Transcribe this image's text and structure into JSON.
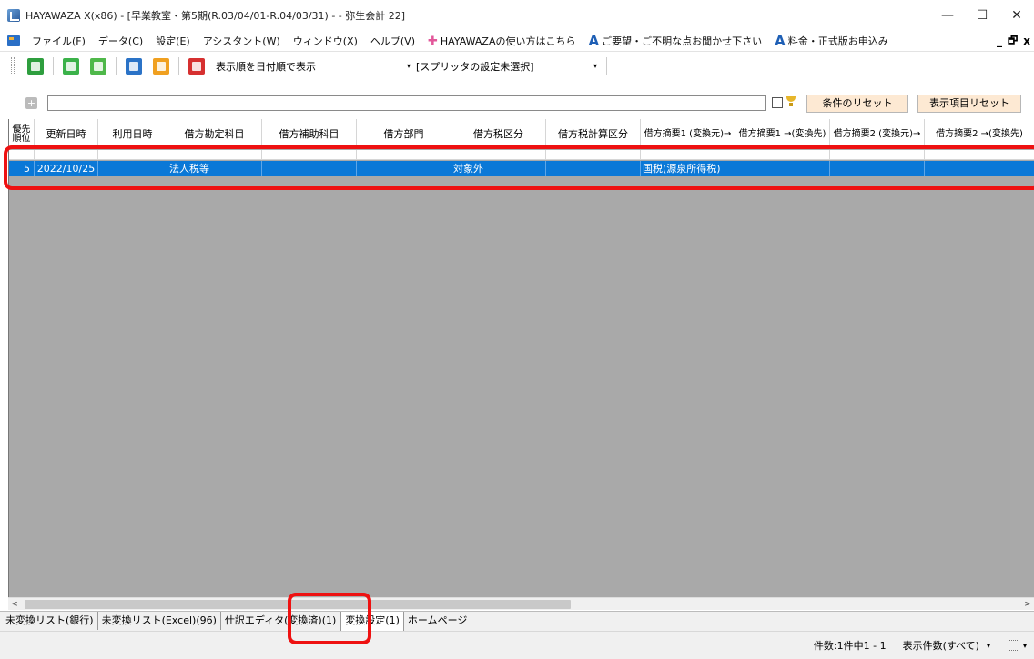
{
  "window": {
    "title": "HAYAWAZA X(x86) - [早業教室・第5期(R.03/04/01-R.04/03/31) - - 弥生会計 22]",
    "minimize": "—",
    "maximize": "☐",
    "close": "✕"
  },
  "menu": {
    "items": [
      "ファイル(F)",
      "データ(C)",
      "設定(E)",
      "アシスタント(W)",
      "ウィンドウ(X)",
      "ヘルプ(V)"
    ],
    "howto": "HAYAWAZAの使い方はこちら",
    "feedback": "ご要望・ご不明な点お聞かせ下さい",
    "pricing": "料金・正式版お申込み",
    "mdi_min": "_",
    "mdi_restore": "🗗",
    "mdi_close": "x"
  },
  "toolbar": {
    "sort_label": "表示順を日付順で表示",
    "spliter_label": "[スプリッタの設定未選択]",
    "arrow": "▾"
  },
  "filter": {
    "expand": "+",
    "reset_conditions": "条件のリセット",
    "reset_columns": "表示項目リセット"
  },
  "grid": {
    "columns": [
      {
        "label": "優先順位",
        "small": true
      },
      {
        "label": "更新日時"
      },
      {
        "label": "利用日時"
      },
      {
        "label": "借方勘定科目"
      },
      {
        "label": "借方補助科目"
      },
      {
        "label": "借方部門"
      },
      {
        "label": "借方税区分"
      },
      {
        "label": "借方税計算区分"
      },
      {
        "label": "借方摘要1 (変換元)→",
        "small": true
      },
      {
        "label": "借方摘要1 →(変換先)",
        "small": true
      },
      {
        "label": "借方摘要2 (変換元)→",
        "small": true
      },
      {
        "label": "借方摘要2 →(変換先)",
        "small": true
      }
    ],
    "rows": [
      {
        "cells": [
          "5",
          "2022/10/25",
          "",
          "法人税等",
          "",
          "",
          "対象外",
          "",
          "国税(源泉所得税)",
          "",
          "",
          ""
        ]
      }
    ]
  },
  "scroll": {
    "left": "<",
    "right": ">"
  },
  "tabs": [
    "未変換リスト(銀行)",
    "未変換リスト(Excel)(96)",
    "仕訳エディタ(変換済)(1)",
    "変換設定(1)",
    "ホームページ"
  ],
  "active_tab": 3,
  "status": {
    "count": "件数:1件中1 - 1",
    "display": "表示件数(すべて)",
    "arrow": "▾"
  }
}
